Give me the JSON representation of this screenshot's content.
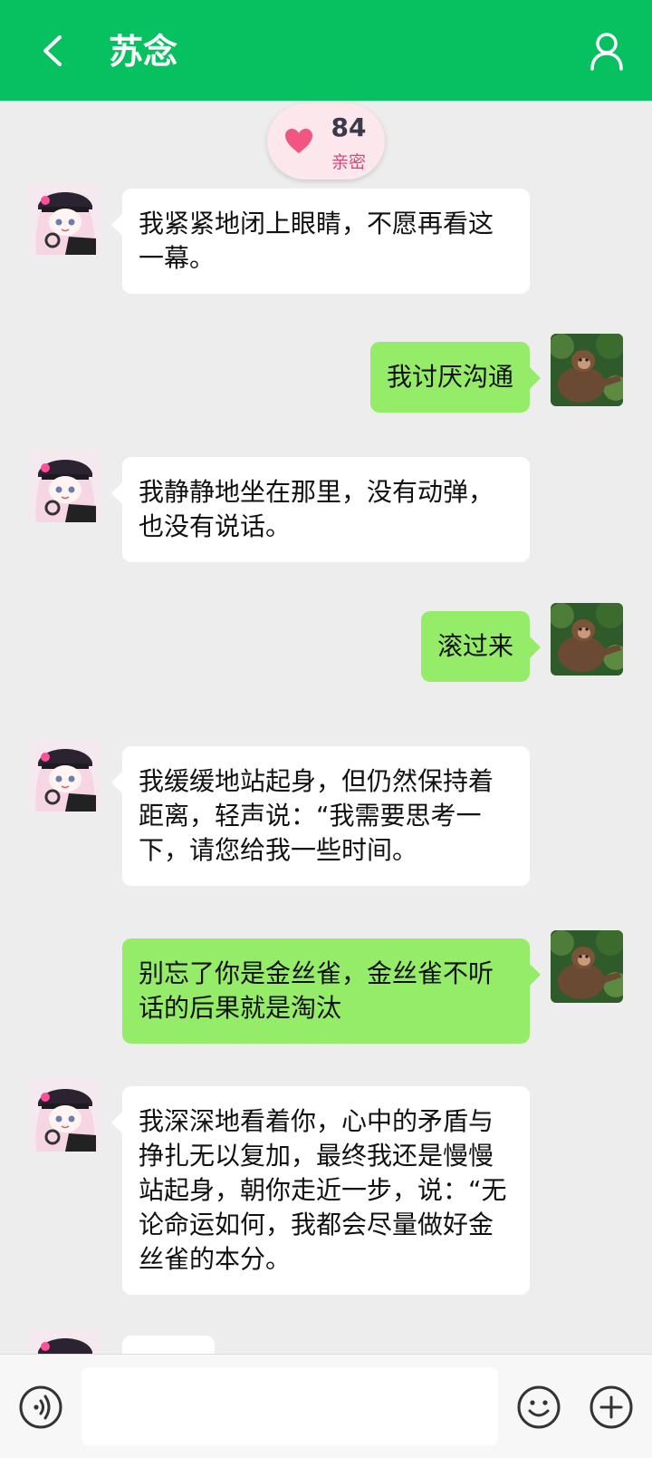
{
  "header": {
    "title": "苏念",
    "background_color": "#07c160",
    "back_icon": "chevron-left-icon",
    "profile_icon": "user-icon"
  },
  "intimacy": {
    "value": "84",
    "label": "亲密",
    "icon": "heart-icon"
  },
  "messages": [
    {
      "side": "left",
      "text": "我紧紧地闭上眼睛，不愿再看这一幕。"
    },
    {
      "side": "right",
      "text": "我讨厌沟通"
    },
    {
      "side": "left",
      "text": "我静静地坐在那里，没有动弹，也没有说话。"
    },
    {
      "side": "right",
      "text": "滚过来"
    },
    {
      "side": "left",
      "text": "我缓缓地站起身，但仍然保持着距离，轻声说：“我需要思考一下，请您给我一些时间。"
    },
    {
      "side": "right",
      "text": "别忘了你是金丝雀，金丝雀不听话的后果就是淘汰"
    },
    {
      "side": "left",
      "text": "我深深地看着你，心中的矛盾与挣扎无以复加，最终我还是慢慢站起身，朝你走近一步，说：“无论命运如何，我都会尽量做好金丝雀的本分。"
    }
  ],
  "colors": {
    "my_bubble": "#95ec69",
    "their_bubble": "#ffffff",
    "chat_background": "#ededed"
  },
  "input_bar": {
    "voice_icon": "voice-icon",
    "emoji_icon": "smiley-icon",
    "plus_icon": "plus-circle-icon",
    "input_value": ""
  }
}
